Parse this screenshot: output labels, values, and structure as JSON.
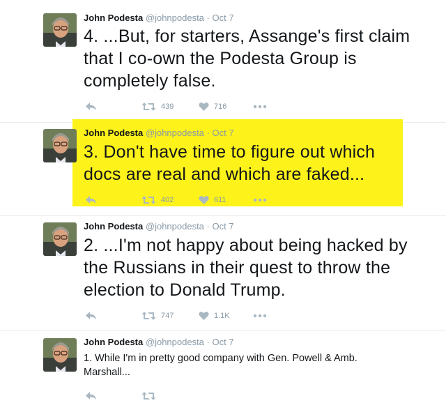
{
  "tweets": [
    {
      "name": "John Podesta",
      "handle": "@johnpodesta",
      "separator": "·",
      "time": "Oct 7",
      "text": "4. ...But, for starters, Assange's first claim that I co-own the Podesta Group is completely false.",
      "retweets": "439",
      "likes": "716",
      "highlighted": false
    },
    {
      "name": "John Podesta",
      "handle": "@johnpodesta",
      "separator": "·",
      "time": "Oct 7",
      "text": "3. Don't have time to figure out which docs are real and which are faked...",
      "retweets": "402",
      "likes": "611",
      "highlighted": true
    },
    {
      "name": "John Podesta",
      "handle": "@johnpodesta",
      "separator": "·",
      "time": "Oct 7",
      "text": "2. ...I'm not happy about being hacked by the Russians in their quest to throw the election to Donald Trump.",
      "retweets": "747",
      "likes": "1.1K",
      "highlighted": false
    },
    {
      "name": "John Podesta",
      "handle": "@johnpodesta",
      "separator": "·",
      "time": "Oct 7",
      "text": "1. While I'm in pretty good company with Gen. Powell & Amb. Marshall...",
      "highlighted": false
    }
  ],
  "icons": {
    "reply": "reply-icon",
    "retweet": "retweet-icon",
    "like": "heart-icon",
    "more": "more-icon"
  },
  "colors": {
    "highlight": "#fdf21a",
    "action_gray": "#aab8c2",
    "meta_gray": "#8899a6",
    "text": "#14171a"
  }
}
